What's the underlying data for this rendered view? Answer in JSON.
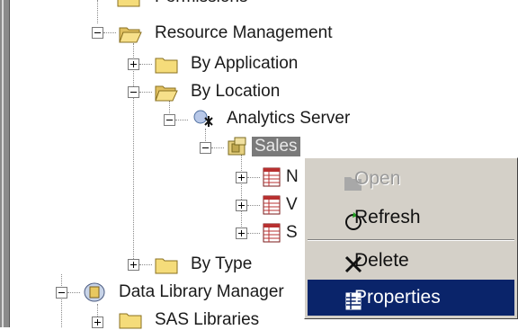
{
  "tree": {
    "items": [
      {
        "label": "Permissions"
      },
      {
        "label": "Resource Management"
      },
      {
        "label": "By Application"
      },
      {
        "label": "By Location"
      },
      {
        "label": "Analytics Server"
      },
      {
        "label": "Sales"
      },
      {
        "label": "By Type"
      },
      {
        "label": "Data Library Manager"
      },
      {
        "label": "SAS Libraries"
      }
    ],
    "child_labels": [
      "N",
      "V",
      "S"
    ]
  },
  "context_menu": {
    "items": [
      {
        "label": "Open",
        "icon": "open-icon",
        "state": "disabled"
      },
      {
        "label": "Refresh",
        "icon": "refresh-icon",
        "state": "normal"
      },
      {
        "label": "Delete",
        "icon": "delete-icon",
        "state": "normal"
      },
      {
        "label": "Properties",
        "icon": "properties-icon",
        "state": "highlighted"
      }
    ]
  },
  "colors": {
    "highlight": "#0a246a",
    "menu_bg": "#d4d0c8",
    "selection_bg": "#7a7a7a"
  }
}
